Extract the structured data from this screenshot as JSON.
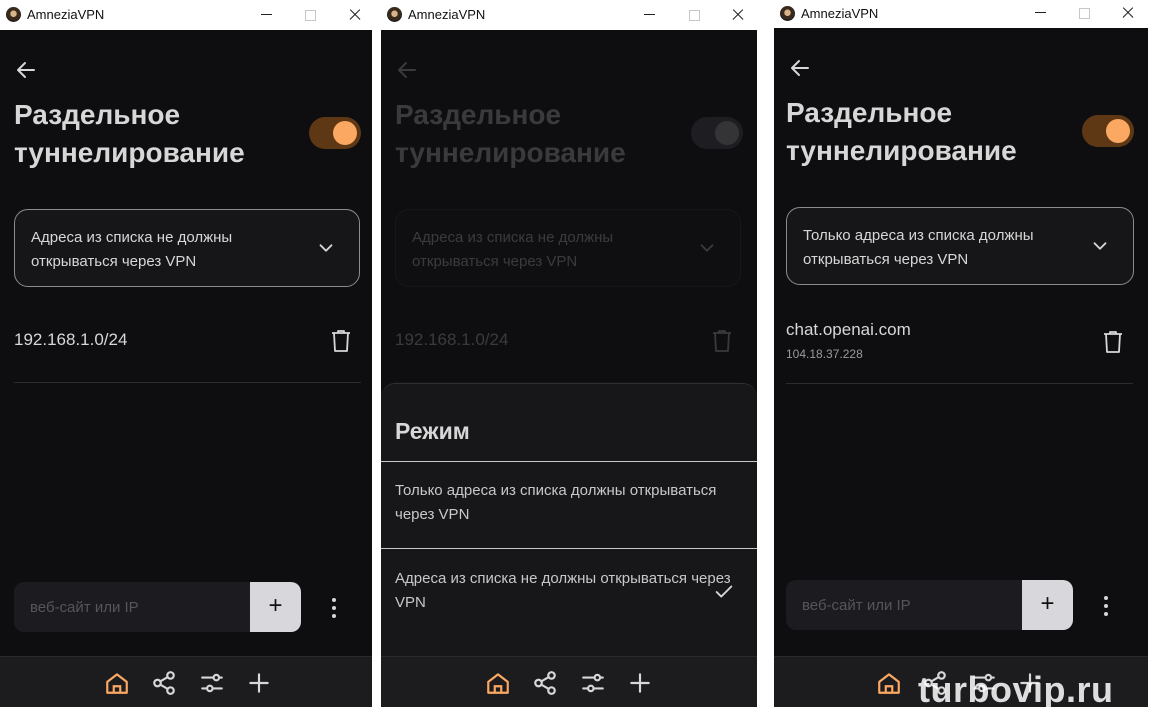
{
  "app_title": "AmneziaVPN",
  "page_title": "Раздельное туннелирование",
  "input_placeholder": "веб-сайт или IP",
  "add_label": "+",
  "screen1": {
    "mode": "Адреса из списка не должны открываться через VPN",
    "entry": "192.168.1.0/24"
  },
  "screen2": {
    "mode": "Адреса из списка не должны открываться через VPN",
    "entry": "192.168.1.0/24",
    "sheet_title": "Режим",
    "options": [
      "Только адреса из списка должны открываться через VPN",
      "Адреса из списка не должны открываться через VPN"
    ]
  },
  "screen3": {
    "mode": "Только адреса из списка должны открываться через VPN",
    "entry_host": "chat.openai.com",
    "entry_ip": "104.18.37.228"
  },
  "watermark": "turbovip.ru",
  "colors": {
    "accent": "#fba862",
    "toggle_track": "#5e3814",
    "background": "#0e0e11"
  },
  "icons": [
    "back-arrow-icon",
    "toggle-switch",
    "chevron-down-icon",
    "trash-icon",
    "more-vertical-icon",
    "home-icon",
    "share-icon",
    "settings-sliders-icon",
    "plus-icon",
    "checkmark-icon"
  ]
}
